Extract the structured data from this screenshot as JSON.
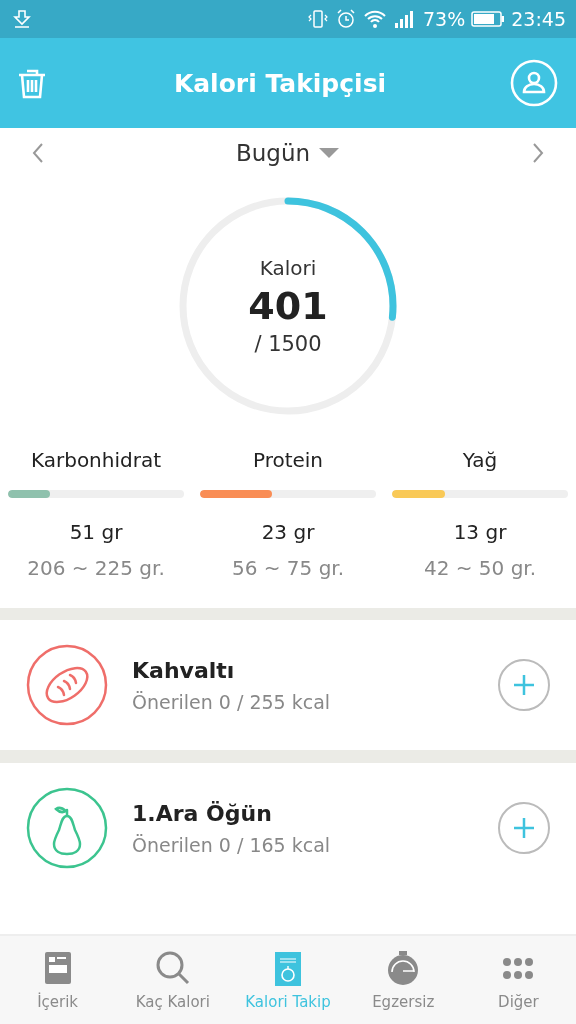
{
  "status_bar": {
    "battery": "73%",
    "time": "23:45"
  },
  "app_bar": {
    "title": "Kalori Takipçisi"
  },
  "date_nav": {
    "label": "Bugün"
  },
  "calories": {
    "label": "Kalori",
    "value": "401",
    "goal": "/ 1500",
    "level": 0.267
  },
  "macros": [
    {
      "name": "Karbonhidrat",
      "color": "#8fc1ad",
      "level": 0.24,
      "amount": "51 gr",
      "range": "206 ~ 225 gr."
    },
    {
      "name": "Protein",
      "color": "#f98d55",
      "level": 0.41,
      "amount": "23 gr",
      "range": "56 ~ 75 gr."
    },
    {
      "name": "Yağ",
      "color": "#f9c957",
      "level": 0.3,
      "amount": "13 gr",
      "range": "42 ~ 50 gr."
    }
  ],
  "meals": [
    {
      "kind": "bread",
      "color": "#ef6e6a",
      "title": "Kahvaltı",
      "subtitle": "Önerilen 0 / 255 kcal"
    },
    {
      "kind": "pear",
      "color": "#3cc48f",
      "title": "1.Ara Öğün",
      "subtitle": "Önerilen 0 / 165 kcal"
    }
  ],
  "bottom_nav": [
    {
      "kind": "content",
      "label": "İçerik",
      "selected": false
    },
    {
      "kind": "search",
      "label": "Kaç Kalori",
      "selected": false
    },
    {
      "kind": "tracker",
      "label": "Kalori Takip",
      "selected": true
    },
    {
      "kind": "timer",
      "label": "Egzersiz",
      "selected": false
    },
    {
      "kind": "more",
      "label": "Diğer",
      "selected": false
    }
  ]
}
